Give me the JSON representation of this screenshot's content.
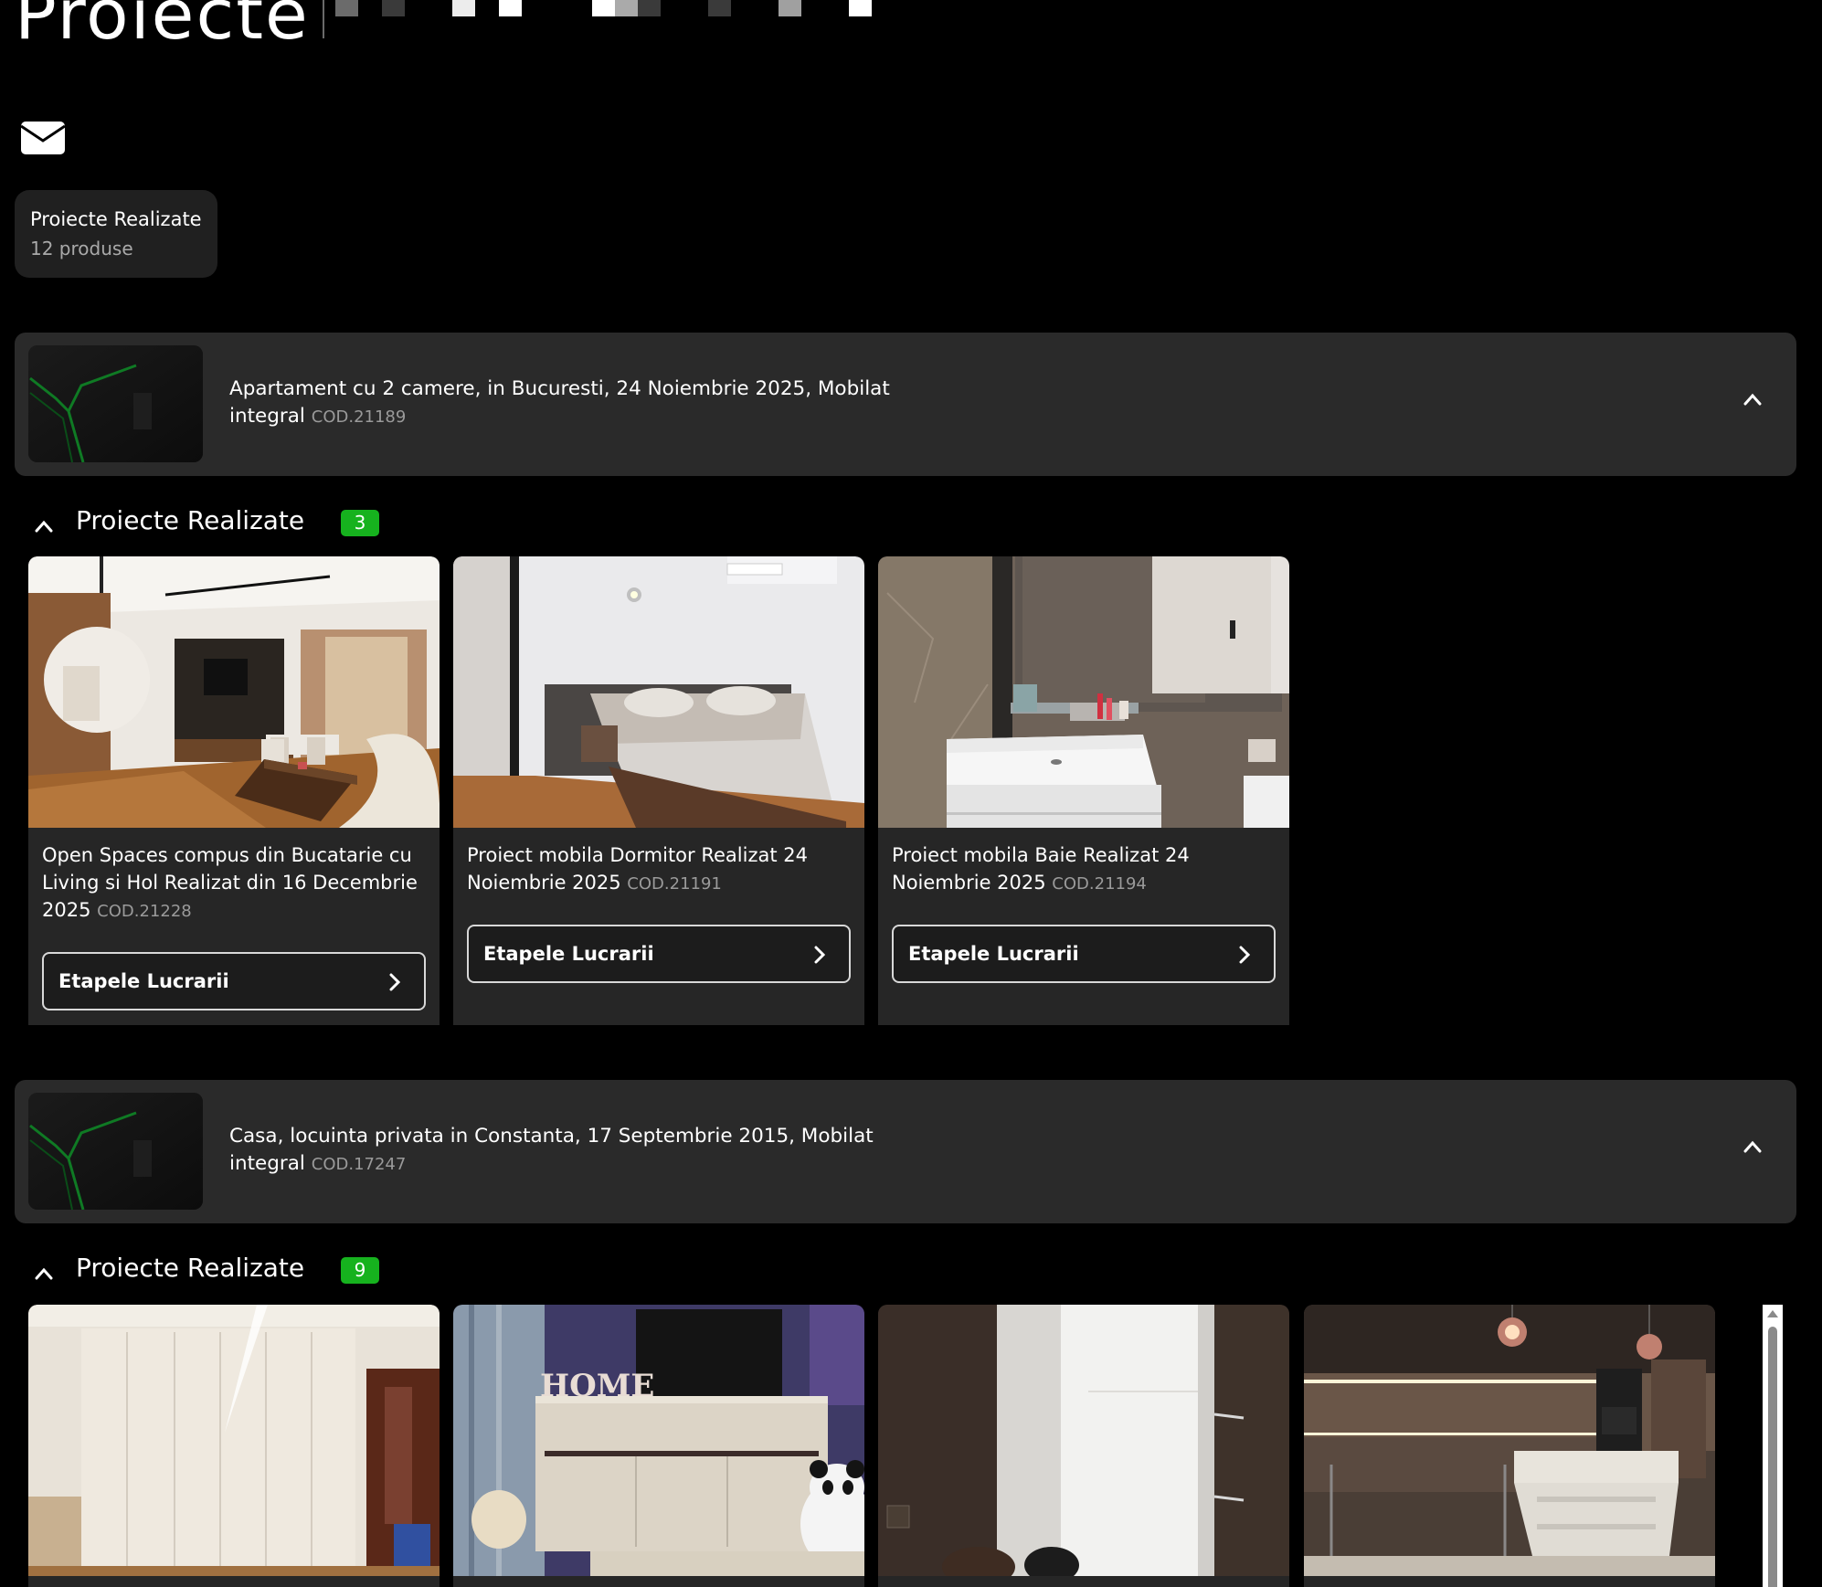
{
  "header": {
    "title": "Proiecte",
    "mail_icon": "envelope-icon"
  },
  "category": {
    "name": "Proiecte Realizate",
    "count": "12 produse"
  },
  "projects": [
    {
      "title": "Apartament cu 2 camere, in Bucuresti, 24 Noiembrie 2025, Mobilat integral",
      "code": "COD.21189",
      "section_title": "Proiecte Realizate",
      "section_count": "3",
      "products": [
        {
          "title": "Open Spaces compus din Bucatarie cu Living si Hol Realizat din 16 Decembrie 2025",
          "code": "COD.21228",
          "button": "Etapele Lucrarii"
        },
        {
          "title": "Proiect mobila Dormitor Realizat 24 Noiembrie 2025",
          "code": "COD.21191",
          "button": "Etapele Lucrarii"
        },
        {
          "title": "Proiect mobila Baie Realizat 24 Noiembrie 2025",
          "code": "COD.21194",
          "button": "Etapele Lucrarii"
        }
      ]
    },
    {
      "title": "Casa, locuinta privata in Constanta, 17 Septembrie 2015, Mobilat integral",
      "code": "COD.17247",
      "section_title": "Proiecte Realizate",
      "section_count": "9",
      "product_photo_text": "HOME"
    }
  ],
  "colors": {
    "background": "#000000",
    "bar": "#2a2a2a",
    "card": "#262626",
    "badge": "#16b21e",
    "muted": "#9a9a9a"
  }
}
